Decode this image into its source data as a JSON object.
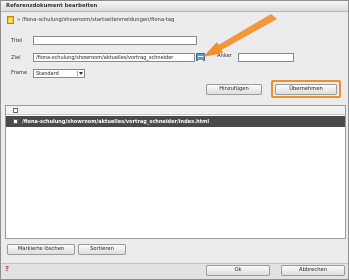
{
  "window": {
    "title": "Referenzdokument bearbeiten"
  },
  "breadcrumb": {
    "path": "» /fiona-schulung/showroom/startseitenmeldungen/fiona-tag",
    "icon": "document-icon"
  },
  "form": {
    "titel_label": "Titel",
    "titel_value": "",
    "ziel_label": "Ziel",
    "ziel_value": "/fiona-schulung/showroom/aktuelles/vortrag_schneider",
    "anker_label": "Anker",
    "anker_value": "",
    "frame_label": "Frame",
    "frame_value": "Standard"
  },
  "buttons": {
    "hinzufuegen": "Hinzufügen",
    "uebernehmen": "Übernehmen",
    "markierte_loeschen": "Markierte löschen",
    "sortieren": "Sortieren",
    "ok": "Ok",
    "abbrechen": "Abbrechen"
  },
  "table": {
    "rows": [
      {
        "path": "/fiona-schulung/showroom/aktuelles/vortrag_schneider/index.html",
        "selected": true
      }
    ]
  },
  "colors": {
    "highlight": "#f0902a",
    "selected_row": "#4a4a4a",
    "browse": "#5c9bd6"
  }
}
